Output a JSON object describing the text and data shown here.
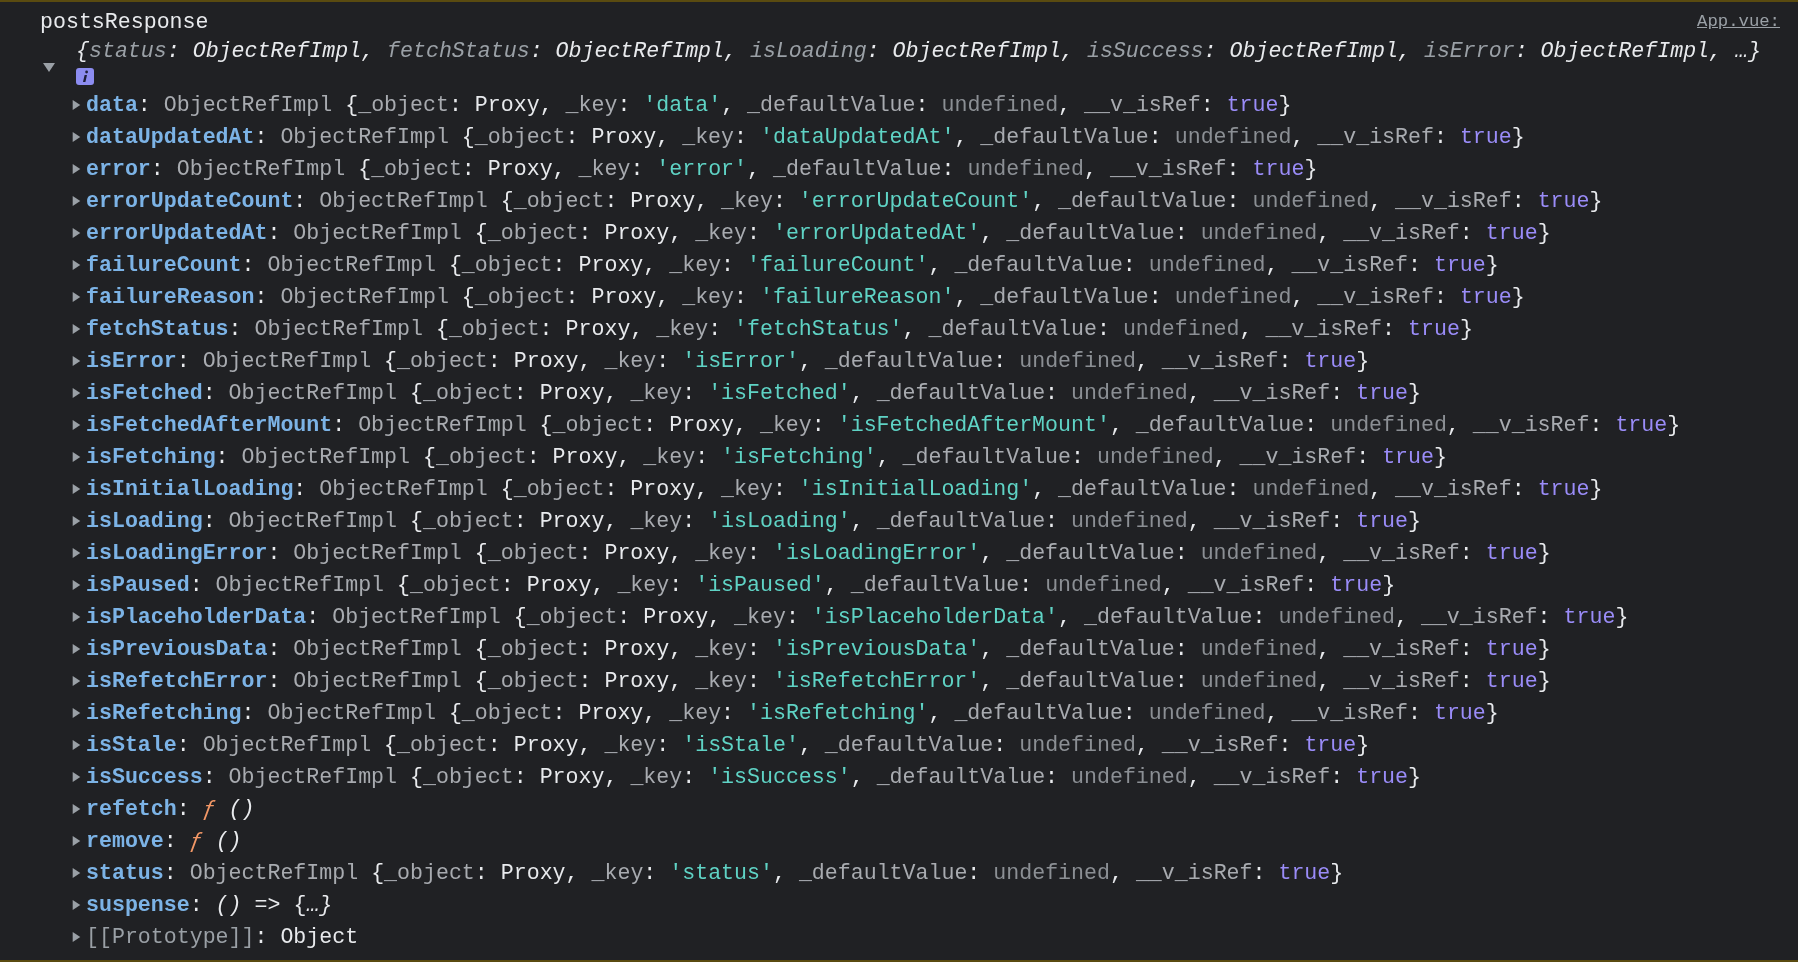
{
  "log_label": "postsResponse",
  "source_link": "App.vue:",
  "object": {
    "summary": "{status: ObjectRefImpl, fetchStatus: ObjectRefImpl, isLoading: ObjectRefImpl, isSuccess: ObjectRefImpl, isError: ObjectRefImpl, …}",
    "expanded": true,
    "properties": [
      {
        "kind": "property",
        "expanded": false,
        "text": "data: ObjectRefImpl {_object: Proxy, _key: 'data', _defaultValue: undefined, __v_isRef: true}"
      },
      {
        "kind": "property",
        "expanded": false,
        "text": "dataUpdatedAt: ObjectRefImpl {_object: Proxy, _key: 'dataUpdatedAt', _defaultValue: undefined, __v_isRef: true}"
      },
      {
        "kind": "property",
        "expanded": false,
        "text": "error: ObjectRefImpl {_object: Proxy, _key: 'error', _defaultValue: undefined, __v_isRef: true}"
      },
      {
        "kind": "property",
        "expanded": false,
        "text": "errorUpdateCount: ObjectRefImpl {_object: Proxy, _key: 'errorUpdateCount', _defaultValue: undefined, __v_isRef: true}"
      },
      {
        "kind": "property",
        "expanded": false,
        "text": "errorUpdatedAt: ObjectRefImpl {_object: Proxy, _key: 'errorUpdatedAt', _defaultValue: undefined, __v_isRef: true}"
      },
      {
        "kind": "property",
        "expanded": false,
        "text": "failureCount: ObjectRefImpl {_object: Proxy, _key: 'failureCount', _defaultValue: undefined, __v_isRef: true}"
      },
      {
        "kind": "property",
        "expanded": false,
        "text": "failureReason: ObjectRefImpl {_object: Proxy, _key: 'failureReason', _defaultValue: undefined, __v_isRef: true}"
      },
      {
        "kind": "property",
        "expanded": false,
        "text": "fetchStatus: ObjectRefImpl {_object: Proxy, _key: 'fetchStatus', _defaultValue: undefined, __v_isRef: true}"
      },
      {
        "kind": "property",
        "expanded": false,
        "text": "isError: ObjectRefImpl {_object: Proxy, _key: 'isError', _defaultValue: undefined, __v_isRef: true}"
      },
      {
        "kind": "property",
        "expanded": false,
        "text": "isFetched: ObjectRefImpl {_object: Proxy, _key: 'isFetched', _defaultValue: undefined, __v_isRef: true}"
      },
      {
        "kind": "property",
        "expanded": false,
        "text": "isFetchedAfterMount: ObjectRefImpl {_object: Proxy, _key: 'isFetchedAfterMount', _defaultValue: undefined, __v_isRef: true}"
      },
      {
        "kind": "property",
        "expanded": false,
        "text": "isFetching: ObjectRefImpl {_object: Proxy, _key: 'isFetching', _defaultValue: undefined, __v_isRef: true}"
      },
      {
        "kind": "property",
        "expanded": false,
        "text": "isInitialLoading: ObjectRefImpl {_object: Proxy, _key: 'isInitialLoading', _defaultValue: undefined, __v_isRef: true}"
      },
      {
        "kind": "property",
        "expanded": false,
        "text": "isLoading: ObjectRefImpl {_object: Proxy, _key: 'isLoading', _defaultValue: undefined, __v_isRef: true}"
      },
      {
        "kind": "property",
        "expanded": false,
        "text": "isLoadingError: ObjectRefImpl {_object: Proxy, _key: 'isLoadingError', _defaultValue: undefined, __v_isRef: true}"
      },
      {
        "kind": "property",
        "expanded": false,
        "text": "isPaused: ObjectRefImpl {_object: Proxy, _key: 'isPaused', _defaultValue: undefined, __v_isRef: true}"
      },
      {
        "kind": "property",
        "expanded": false,
        "text": "isPlaceholderData: ObjectRefImpl {_object: Proxy, _key: 'isPlaceholderData', _defaultValue: undefined, __v_isRef: true}"
      },
      {
        "kind": "property",
        "expanded": false,
        "text": "isPreviousData: ObjectRefImpl {_object: Proxy, _key: 'isPreviousData', _defaultValue: undefined, __v_isRef: true}"
      },
      {
        "kind": "property",
        "expanded": false,
        "text": "isRefetchError: ObjectRefImpl {_object: Proxy, _key: 'isRefetchError', _defaultValue: undefined, __v_isRef: true}"
      },
      {
        "kind": "property",
        "expanded": false,
        "text": "isRefetching: ObjectRefImpl {_object: Proxy, _key: 'isRefetching', _defaultValue: undefined, __v_isRef: true}"
      },
      {
        "kind": "property",
        "expanded": false,
        "text": "isStale: ObjectRefImpl {_object: Proxy, _key: 'isStale', _defaultValue: undefined, __v_isRef: true}"
      },
      {
        "kind": "property",
        "expanded": false,
        "text": "isSuccess: ObjectRefImpl {_object: Proxy, _key: 'isSuccess', _defaultValue: undefined, __v_isRef: true}"
      },
      {
        "kind": "property",
        "expanded": false,
        "text": "refetch: ƒ ()"
      },
      {
        "kind": "property",
        "expanded": false,
        "text": "remove: ƒ ()"
      },
      {
        "kind": "property",
        "expanded": false,
        "text": "status: ObjectRefImpl {_object: Proxy, _key: 'status', _defaultValue: undefined, __v_isRef: true}"
      },
      {
        "kind": "property",
        "expanded": false,
        "text": "suspense: () => {…}"
      },
      {
        "kind": "prototype",
        "expanded": false,
        "text": "[[Prototype]]: Object"
      }
    ]
  }
}
